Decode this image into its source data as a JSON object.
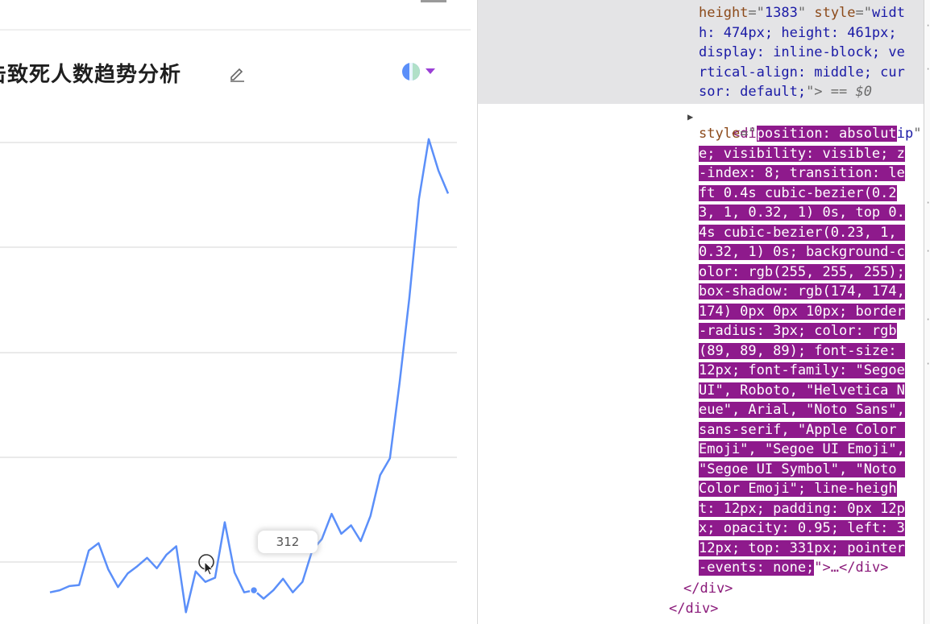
{
  "chart_panel": {
    "title": "击致死人数趋势分析",
    "edit_icon": "pencil-icon",
    "theme_icon": "theme-palette-icon",
    "tooltip_value": "312",
    "line_color": "#5b8ff9"
  },
  "chart_data": {
    "type": "line",
    "grid": true,
    "values": [
      298,
      300,
      304,
      305,
      338,
      345,
      320,
      303,
      316,
      323,
      331,
      321,
      334,
      342,
      279,
      318,
      308,
      312,
      365,
      317,
      298,
      300,
      292,
      300,
      311,
      298,
      308,
      338,
      349,
      373,
      354,
      362,
      347,
      371,
      410,
      426,
      498,
      579,
      674,
      731,
      701,
      679
    ]
  },
  "devtools": {
    "lines": [
      {
        "t": "height=\"1383\" style=\"widt",
        "segs": [
          [
            "attr",
            "height"
          ],
          [
            "eq",
            "=\""
          ],
          [
            "val",
            "1383"
          ],
          [
            "eq",
            "\" "
          ],
          [
            "attr",
            "style"
          ],
          [
            "eq",
            "=\""
          ],
          [
            "val",
            "widt"
          ]
        ]
      },
      {
        "segs": [
          [
            "val",
            "h: 474px; height: 461px;"
          ]
        ]
      },
      {
        "segs": [
          [
            "val",
            "display: inline-block; ve"
          ]
        ]
      },
      {
        "segs": [
          [
            "val",
            "rtical-align: middle; cur"
          ]
        ]
      },
      {
        "segs": [
          [
            "val",
            "sor: default;"
          ],
          [
            "eq",
            "\">"
          ],
          [
            "eq",
            " == "
          ],
          [
            "eq",
            "$0"
          ]
        ]
      }
    ],
    "tooltip_div_open": "<div",
    "tooltip_div_class_attr": "class",
    "tooltip_div_class_val": "g2-tooltip",
    "style_attr": "style",
    "style_lines": [
      "position: absolut",
      "e; visibility: visible; z",
      "-index: 8; transition: le",
      "ft 0.4s cubic-bezier(0.2",
      "3, 1, 0.32, 1) 0s, top 0.",
      "4s cubic-bezier(0.23, 1, ",
      "0.32, 1) 0s; background-c",
      "olor: rgb(255, 255, 255);",
      "box-shadow: rgb(174, 174,",
      "174) 0px 0px 10px; border",
      "-radius: 3px; color: rgb",
      "(89, 89, 89); font-size: ",
      "12px; font-family: \"Segoe",
      "UI\", Roboto, \"Helvetica N",
      "eue\", Arial, \"Noto Sans\",",
      "sans-serif, \"Apple Color ",
      "Emoji\", \"Segoe UI Emoji\",",
      "\"Segoe UI Symbol\", \"Noto ",
      "Color Emoji\"; line-heigh",
      "t: 12px; padding: 0px 12p",
      "x; opacity: 0.95; left: 3",
      "12px; top: 331px; pointer",
      "-events: none;"
    ],
    "style_tail": "\">…</div>",
    "close_div_1": "</div>",
    "close_div_2": "</div>"
  }
}
